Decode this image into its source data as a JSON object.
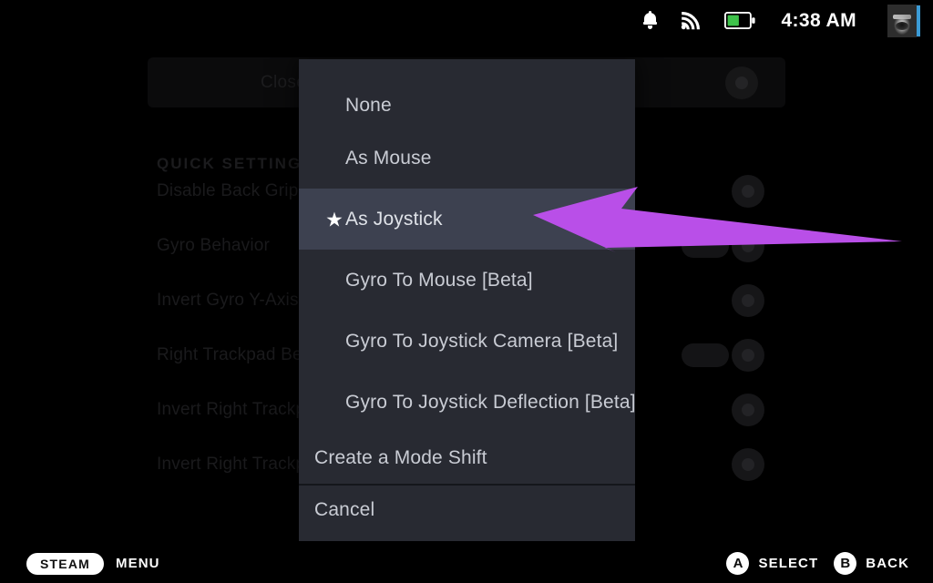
{
  "statusbar": {
    "icons": [
      "bell-icon",
      "wifi-icon",
      "battery-icon"
    ],
    "battery_level_pct": 50,
    "battery_color": "#3fc24b",
    "time": "4:38 AM",
    "avatar": "user-avatar"
  },
  "background": {
    "dimmed": true,
    "top_card": {
      "label": "Close",
      "action_icon": "gear-icon"
    },
    "section_header": "QUICK SETTINGS",
    "rows": [
      {
        "label": "Disable Back Grip Buttons",
        "control": "toggle",
        "action_icon": "gear-icon"
      },
      {
        "label": "Gyro Behavior",
        "control": "dropdown",
        "action_icon": "gear-icon"
      },
      {
        "label": "Invert Gyro Y-Axis",
        "control": "toggle",
        "action_icon": "gear-icon"
      },
      {
        "label": "Right Trackpad Behavior",
        "control": "dropdown",
        "action_icon": "gear-icon"
      },
      {
        "label": "Invert Right Trackpad X",
        "control": "toggle",
        "action_icon": "gear-icon"
      },
      {
        "label": "Invert Right Trackpad Y",
        "control": "toggle",
        "action_icon": "gear-icon"
      }
    ]
  },
  "menu": {
    "background_color": "#282a32",
    "highlight_color": "#3d4150",
    "items": [
      {
        "label": "None",
        "selected": false,
        "starred": false
      },
      {
        "label": "As Mouse",
        "selected": false,
        "starred": false
      },
      {
        "label": "As Joystick",
        "selected": true,
        "starred": true
      },
      {
        "label": "Gyro To Mouse [Beta]",
        "selected": false,
        "starred": false
      },
      {
        "label": "Gyro To Joystick Camera [Beta]",
        "selected": false,
        "starred": false
      },
      {
        "label": "Gyro To Joystick Deflection [Beta]",
        "selected": false,
        "starred": false
      }
    ],
    "create_mode_shift": "Create a Mode Shift",
    "cancel": "Cancel"
  },
  "annotation": {
    "arrow_color": "#b94fe8",
    "points_at": "As Joystick"
  },
  "footer": {
    "steam_pill": "STEAM",
    "menu_label": "MENU",
    "a_button": "A",
    "a_label": "SELECT",
    "b_button": "B",
    "b_label": "BACK"
  }
}
